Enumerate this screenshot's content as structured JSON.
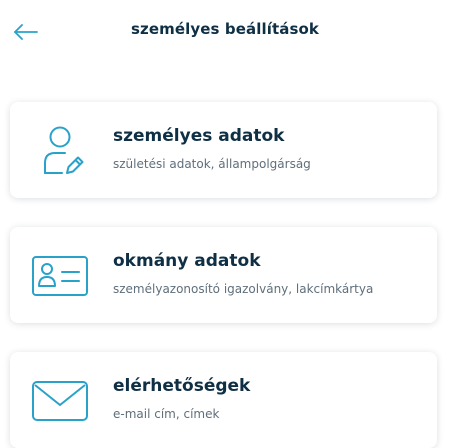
{
  "header": {
    "title": "személyes beállítások",
    "back_icon": "arrow-left-icon"
  },
  "colors": {
    "accent": "#29a2c9",
    "title_text": "#0f2f45",
    "subtitle_text": "#5f6f7b",
    "background": "#ffffff"
  },
  "cards": [
    {
      "title": "személyes adatok",
      "subtitle": "születési adatok, állampolgárság",
      "icon": "person-edit-icon"
    },
    {
      "title": "okmány adatok",
      "subtitle": "személyazonosító igazolvány, lakcímkártya",
      "icon": "id-card-icon"
    },
    {
      "title": "elérhetőségek",
      "subtitle": "e-mail cím, címek",
      "icon": "envelope-icon"
    }
  ]
}
